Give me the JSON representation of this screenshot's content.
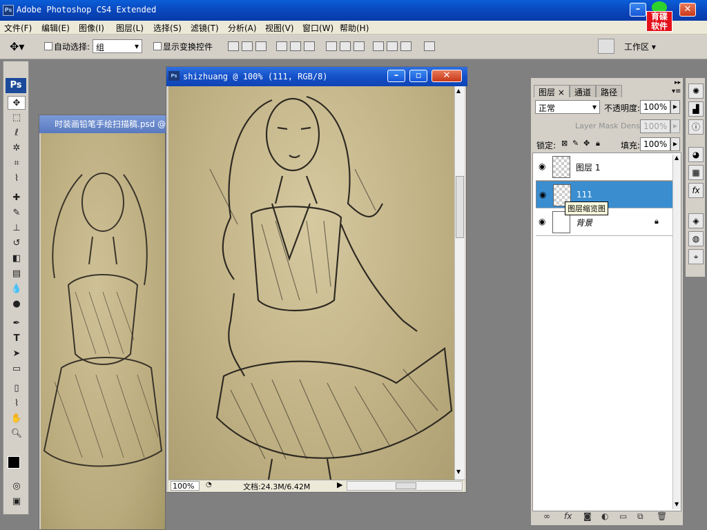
{
  "app": {
    "title": "Adobe Photoshop CS4 Extended",
    "icon": "Ps"
  },
  "logo": {
    "line1": "育碟",
    "line2": "软件"
  },
  "menubar": [
    "文件(F)",
    "编辑(E)",
    "图像(I)",
    "图层(L)",
    "选择(S)",
    "滤镜(T)",
    "分析(A)",
    "视图(V)",
    "窗口(W)",
    "帮助(H)"
  ],
  "options": {
    "auto_select_label": "自动选择:",
    "auto_select_value": "组",
    "show_transform_label": "显示变换控件",
    "workspace_label": "工作区"
  },
  "toolbox": {
    "ps_label": "Ps"
  },
  "doc_back": {
    "title": "时装画铅笔手绘扫描稿.psd @"
  },
  "doc_front": {
    "title": "shizhuang @ 100% (111, RGB/8)",
    "zoom": "100%",
    "doc_info": "文档:24.3M/6.42M"
  },
  "layers_panel": {
    "tabs": [
      "图层",
      "通道",
      "路径"
    ],
    "blend_mode": "正常",
    "opacity_label": "不透明度:",
    "opacity_value": "100%",
    "mask_density_label": "Layer Mask Density",
    "mask_density_value": "100%",
    "lock_label": "锁定:",
    "fill_label": "填充:",
    "fill_value": "100%",
    "layers": [
      {
        "name": "图层 1",
        "selected": false
      },
      {
        "name": "111",
        "selected": true
      },
      {
        "name": "背景",
        "selected": false
      }
    ],
    "tooltip": "图层缩览图",
    "selected_color": "#3a8ed0"
  },
  "icons": {
    "move_tool": "move-icon",
    "eye": "eye-icon",
    "lock": "lock-icon"
  }
}
